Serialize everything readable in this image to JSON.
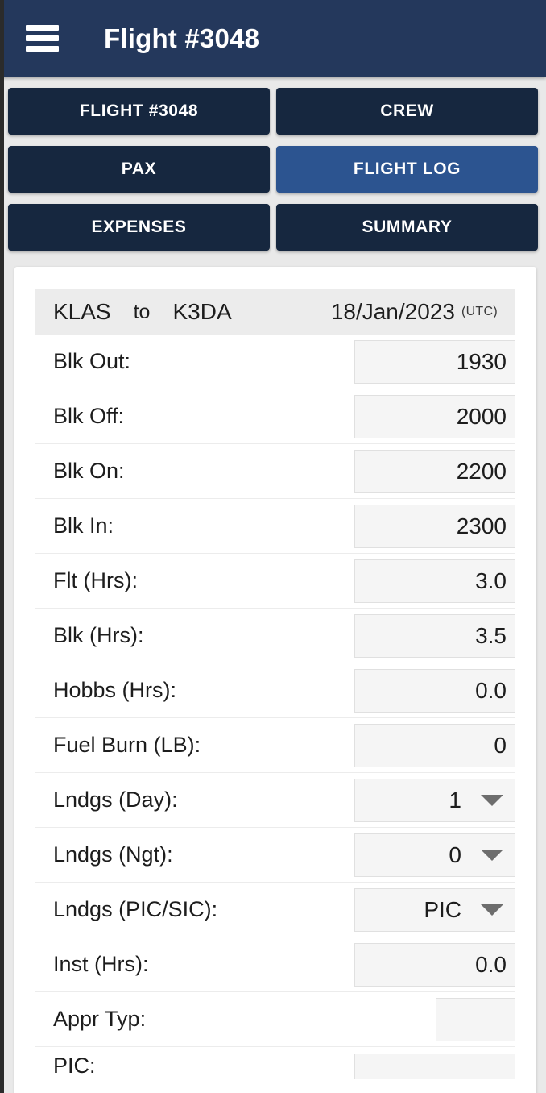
{
  "appbar": {
    "menu_icon": "hamburger-menu-icon",
    "title": "Flight #3048"
  },
  "tabs": [
    {
      "label": "FLIGHT #3048",
      "active": false
    },
    {
      "label": "CREW",
      "active": false
    },
    {
      "label": "PAX",
      "active": false
    },
    {
      "label": "FLIGHT LOG",
      "active": true
    },
    {
      "label": "EXPENSES",
      "active": false
    },
    {
      "label": "SUMMARY",
      "active": false
    }
  ],
  "route": {
    "from": "KLAS",
    "connector": "to",
    "to": "K3DA",
    "date": "18/Jan/2023",
    "timezone": "(UTC)"
  },
  "fields": [
    {
      "label": "Blk Out:",
      "value": "1930",
      "type": "text"
    },
    {
      "label": "Blk Off:",
      "value": "2000",
      "type": "text"
    },
    {
      "label": "Blk On:",
      "value": "2200",
      "type": "text"
    },
    {
      "label": "Blk In:",
      "value": "2300",
      "type": "text"
    },
    {
      "label": "Flt (Hrs):",
      "value": "3.0",
      "type": "text"
    },
    {
      "label": "Blk (Hrs):",
      "value": "3.5",
      "type": "text"
    },
    {
      "label": "Hobbs (Hrs):",
      "value": "0.0",
      "type": "text"
    },
    {
      "label": "Fuel Burn (LB):",
      "value": "0",
      "type": "text"
    },
    {
      "label": "Lndgs (Day):",
      "value": "1",
      "type": "select"
    },
    {
      "label": "Lndgs (Ngt):",
      "value": "0",
      "type": "select"
    },
    {
      "label": "Lndgs (PIC/SIC):",
      "value": "PIC",
      "type": "select"
    },
    {
      "label": "Inst (Hrs):",
      "value": "0.0",
      "type": "text"
    },
    {
      "label": "Appr Typ:",
      "value": "",
      "type": "narrow"
    },
    {
      "label": "PIC:",
      "value": "",
      "type": "text"
    }
  ],
  "colors": {
    "appbar": "#24385c",
    "tab_inactive": "#16273f",
    "tab_active": "#2c5490",
    "page_background": "#e9e9e9",
    "card": "#ffffff",
    "field_fill": "#f5f5f5",
    "caret": "#6d6d6d"
  }
}
